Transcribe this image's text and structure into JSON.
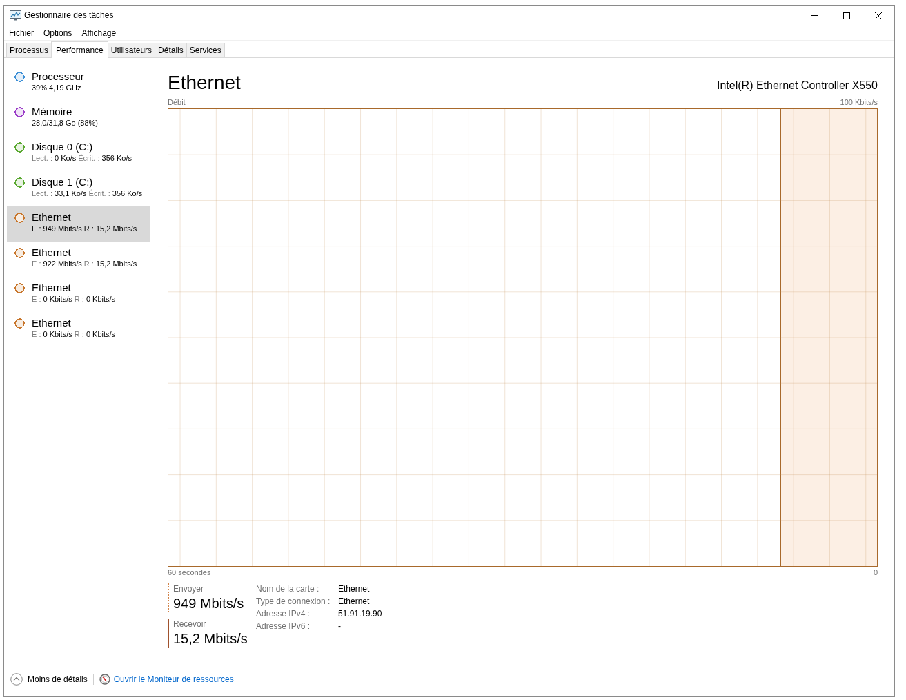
{
  "window": {
    "title": "Gestionnaire des tâches"
  },
  "menu": [
    "Fichier",
    "Options",
    "Affichage"
  ],
  "tabs": [
    {
      "label": "Processus",
      "selected": false
    },
    {
      "label": "Performance",
      "selected": true
    },
    {
      "label": "Utilisateurs",
      "selected": false
    },
    {
      "label": "Détails",
      "selected": false
    },
    {
      "label": "Services",
      "selected": false
    }
  ],
  "sidebar": {
    "items": [
      {
        "title": "Processeur",
        "color": "#3c8fd6",
        "selected": false,
        "stats": [
          {
            "value": "39%"
          },
          {
            "value": "4,19 GHz"
          }
        ]
      },
      {
        "title": "Mémoire",
        "color": "#9b3ec8",
        "selected": false,
        "stats": [
          {
            "value": "28,0/31,8 Go (88%)"
          }
        ]
      },
      {
        "title": "Disque 0 (C:)",
        "color": "#5aa831",
        "selected": false,
        "stats": [
          {
            "label": "Lect. :",
            "value": "0 Ko/s"
          },
          {
            "label": "Écrit. :",
            "value": "356 Ko/s"
          }
        ]
      },
      {
        "title": "Disque 1 (C:)",
        "color": "#5aa831",
        "selected": false,
        "stats": [
          {
            "label": "Lect. :",
            "value": "33,1 Ko/s"
          },
          {
            "label": "Écrit. :",
            "value": "356 Ko/s"
          }
        ]
      },
      {
        "title": "Ethernet",
        "color": "#c8762c",
        "selected": true,
        "stats": [
          {
            "label": "E :",
            "value": "949 Mbits/s"
          },
          {
            "label": "R :",
            "value": "15,2 Mbits/s"
          }
        ]
      },
      {
        "title": "Ethernet",
        "color": "#c8762c",
        "selected": false,
        "stats": [
          {
            "label": "E :",
            "value": "922 Mbits/s"
          },
          {
            "label": "R :",
            "value": "15,2 Mbits/s"
          }
        ]
      },
      {
        "title": "Ethernet",
        "color": "#c8762c",
        "selected": false,
        "stats": [
          {
            "label": "E :",
            "value": "0 Kbits/s"
          },
          {
            "label": "R :",
            "value": "0 Kbits/s"
          }
        ]
      },
      {
        "title": "Ethernet",
        "color": "#c8762c",
        "selected": false,
        "stats": [
          {
            "label": "E :",
            "value": "0 Kbits/s"
          },
          {
            "label": "R :",
            "value": "0 Kbits/s"
          }
        ]
      }
    ]
  },
  "detail": {
    "title": "Ethernet",
    "device": "Intel(R) Ethernet Controller X550",
    "graph": {
      "label": "Débit",
      "max": "100 Kbits/s",
      "span": "60 secondes",
      "min": "0"
    },
    "rates": [
      {
        "kind": "send",
        "label": "Envoyer",
        "value": "949 Mbits/s"
      },
      {
        "kind": "receive",
        "label": "Recevoir",
        "value": "15,2 Mbits/s"
      }
    ],
    "properties": [
      {
        "label": "Nom de la carte :",
        "value": "Ethernet"
      },
      {
        "label": "Type de connexion :",
        "value": "Ethernet"
      },
      {
        "label": "Adresse IPv4 :",
        "value": "51.91.19.90"
      },
      {
        "label": "Adresse IPv6 :",
        "value": "-"
      }
    ]
  },
  "footer": {
    "less_details": "Moins de détails",
    "link": "Ouvrir le Moniteur de ressources"
  }
}
